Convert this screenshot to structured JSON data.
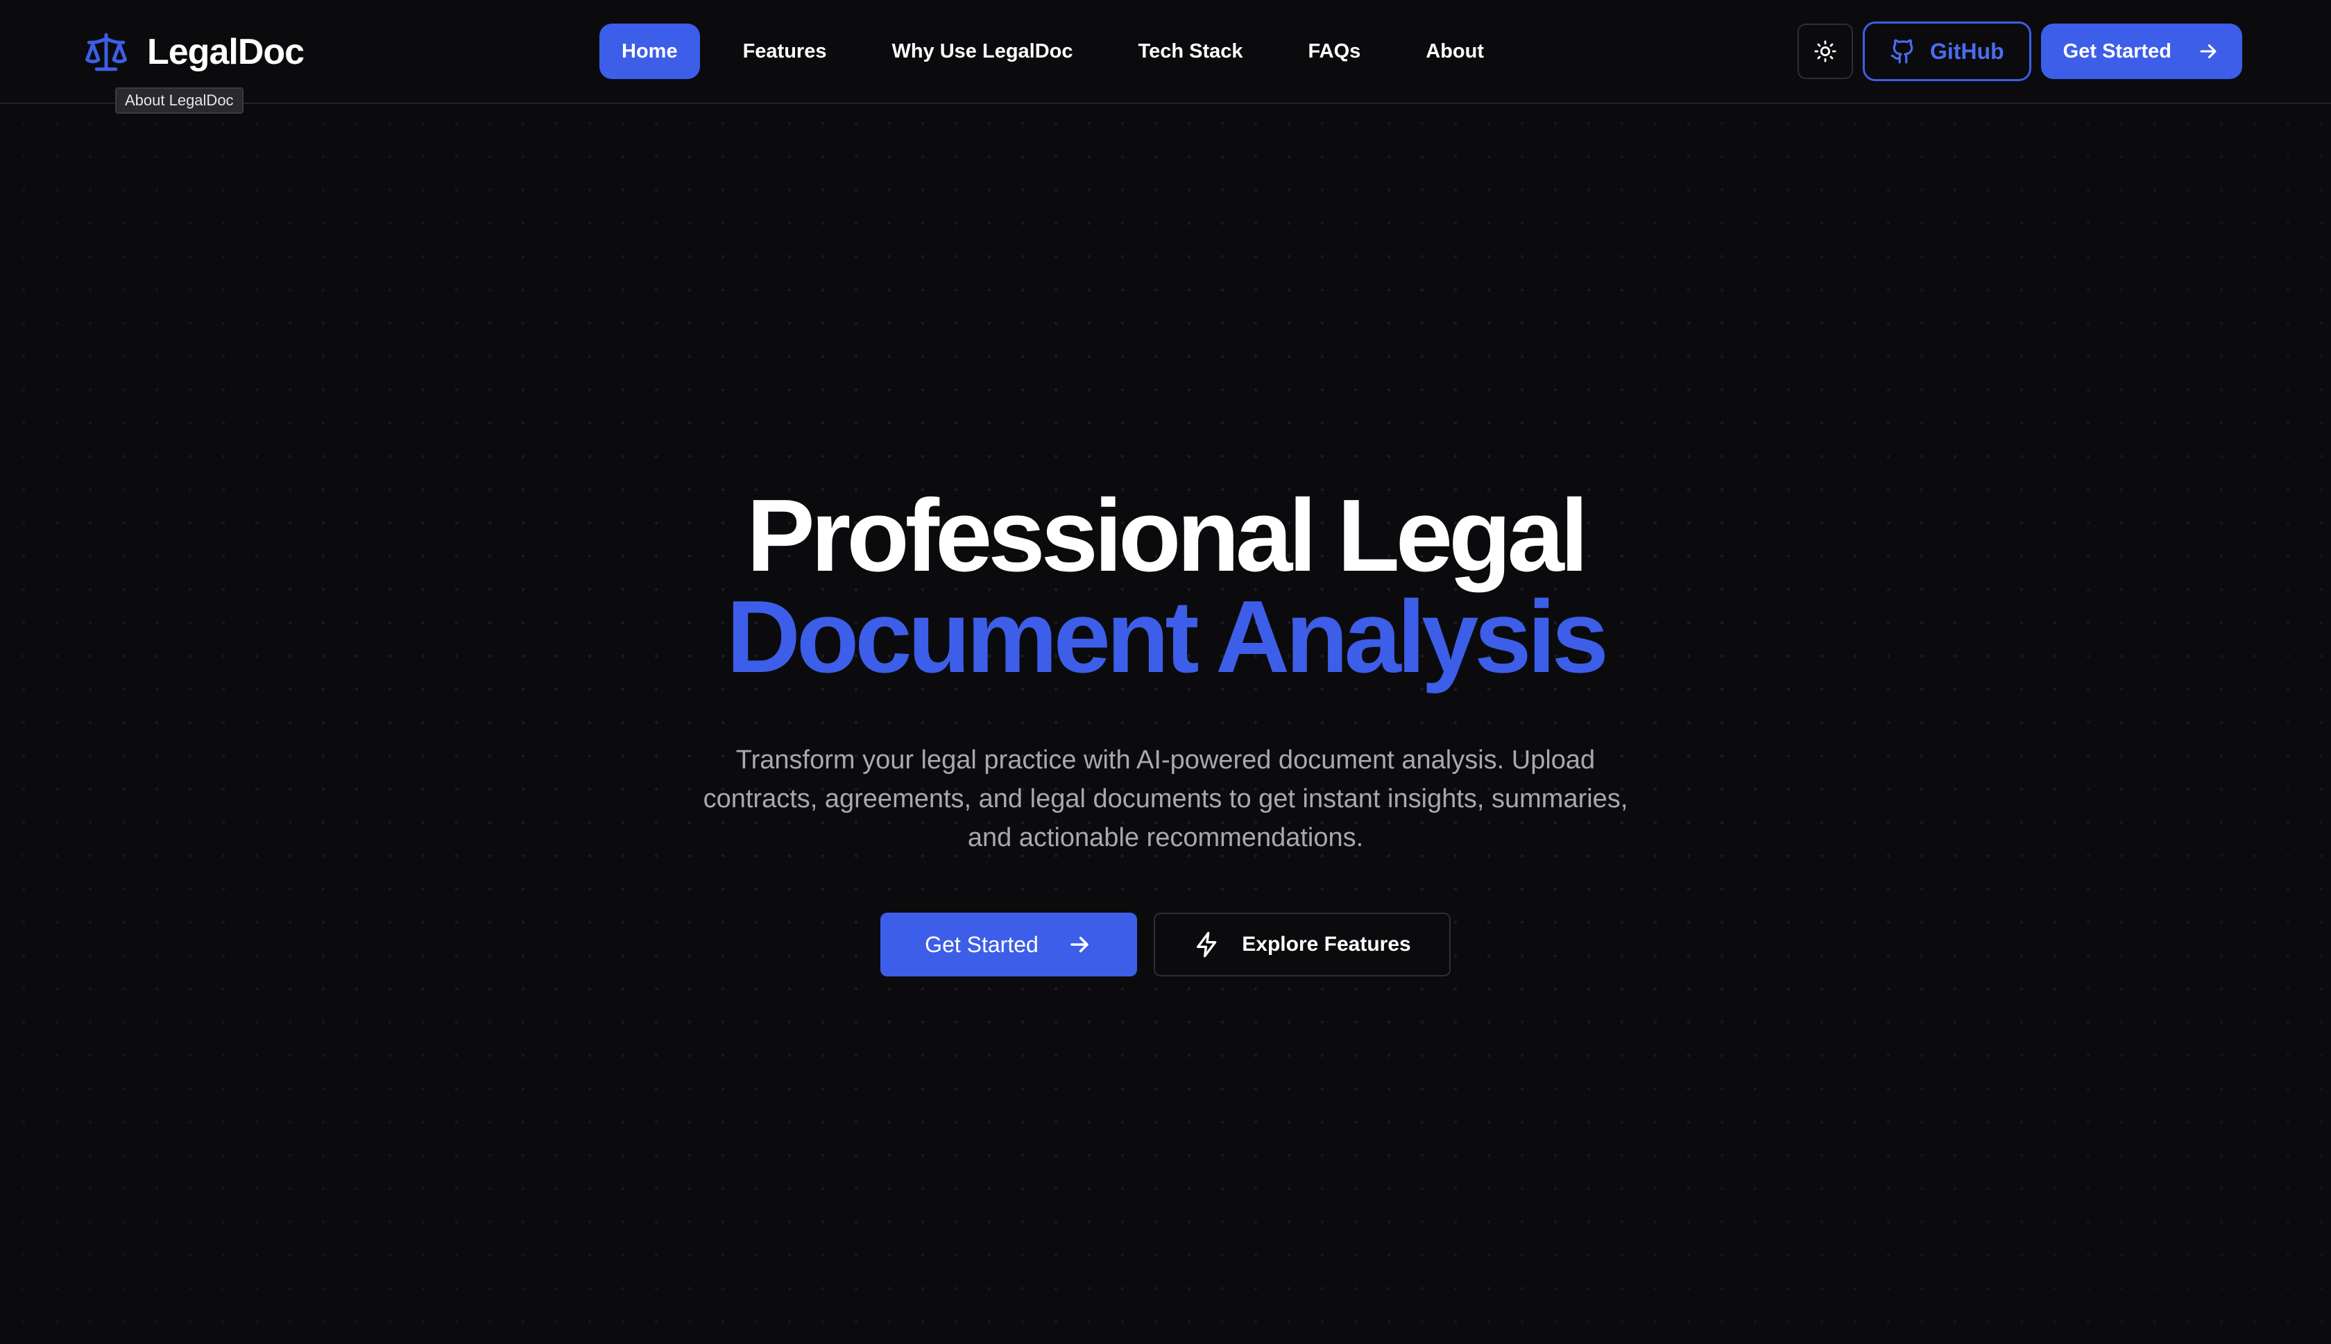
{
  "brand": {
    "name": "LegalDoc",
    "icon": "scale-icon",
    "tooltip": "About LegalDoc"
  },
  "nav": {
    "items": [
      {
        "label": "Home",
        "active": true
      },
      {
        "label": "Features",
        "active": false
      },
      {
        "label": "Why Use LegalDoc",
        "active": false
      },
      {
        "label": "Tech Stack",
        "active": false
      },
      {
        "label": "FAQs",
        "active": false
      },
      {
        "label": "About",
        "active": false
      }
    ],
    "theme_toggle_icon": "sun-icon",
    "github_label": "GitHub",
    "github_icon": "github-icon",
    "cta_label": "Get Started",
    "cta_icon": "arrow-right-icon"
  },
  "hero": {
    "title_line1": "Professional Legal",
    "title_line2": "Document Analysis",
    "subtitle": "Transform your legal practice with AI-powered document analysis. Upload contracts, agreements, and legal documents to get instant insights, summaries, and actionable recommendations.",
    "primary_label": "Get Started",
    "primary_icon": "arrow-right-icon",
    "secondary_label": "Explore Features",
    "secondary_icon": "lightning-icon"
  },
  "colors": {
    "background": "#0b0b0e",
    "accent": "#3d5ee8",
    "text": "#ffffff",
    "muted_text": "#a8a8b0"
  }
}
